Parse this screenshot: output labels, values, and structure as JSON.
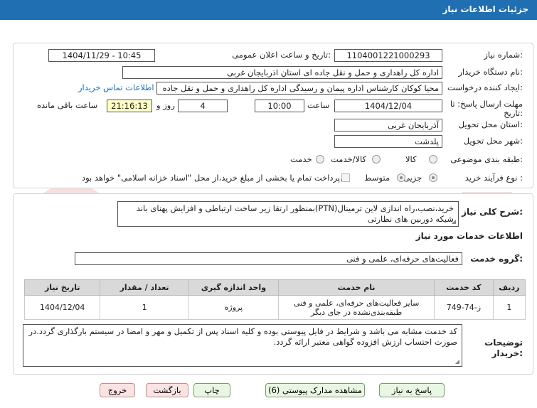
{
  "header": {
    "title": "جزئیات اطلاعات نیاز"
  },
  "form": {
    "need_number_label": "شماره نیاز:",
    "need_number": "1104001221000293",
    "announce_label": "تاریخ و ساعت اعلان عمومی:",
    "announce_value": "1404/11/29 - 10:45",
    "buyer_label": "نام دستگاه خریدار:",
    "buyer_value": "اداره کل راهداری و حمل و نقل جاده ای استان اذربایجان غربی",
    "creator_label": "ایجاد کننده درخواست:",
    "creator_value": "محیا کوکان کارشناس اداره پیمان و رسیدگی اداره کل راهداری و حمل و نقل جاده",
    "contact_link": "اطلاعات تماس خریدار",
    "deadline_label_1": "مهلت ارسال پاسخ: تا",
    "deadline_label_2": "تاریخ:",
    "deadline_date": "1404/12/04",
    "time_label": "ساعت",
    "deadline_time": "10:00",
    "days_value": "4",
    "days_label": "روز و",
    "remaining_time": "21:16:13",
    "remaining_label": "ساعت باقی مانده",
    "province_label": "استان محل تحویل:",
    "province_value": "آذربایجان غربی",
    "city_label": "شهر محل تحویل:",
    "city_value": "پلدشت",
    "category_label": "طبقه بندی موضوعی:",
    "category_options": [
      "کالا",
      "کالا/خدمت",
      "خدمت"
    ],
    "process_label": "نوع فرآیند خرید :",
    "process_options": [
      "جزیی",
      "متوسط"
    ],
    "payment_note": "پرداخت تمام یا بخشی از مبلغ خرید،از محل \"اسناد خزانه اسلامی\" خواهد بود."
  },
  "description": {
    "label": "شرح کلی نیاز:",
    "text": "خرید،نصب،راه اندازی لاین ترمینال(PTN)بمنظور ارتقا زیر ساخت ارتباطی و افزایش پهنای باند شبکه دوربین های نظارتی"
  },
  "services": {
    "section_title": "اطلاعات خدمات مورد نیاز",
    "group_label": "گروه خدمت:",
    "group_value": "فعالیت‌های حرفه‌ای، علمی و فنی",
    "columns": [
      "ردیف",
      "کد خدمت",
      "نام خدمت",
      "واحد اندازه گیری",
      "تعداد / مقدار",
      "تاریخ نیاز"
    ],
    "rows": [
      {
        "idx": "1",
        "code": "ز-74-749",
        "name": "سایر فعالیت‌های حرفه‌ای، علمی و فنی طبقه‌بندی‌نشده در جای دیگر",
        "unit": "پروژه",
        "qty": "1",
        "date": "1404/12/04"
      }
    ]
  },
  "buyer_notes": {
    "label_1": "توضیحات",
    "label_2": "خریدار:",
    "text": "کد خدمت مشابه می باشد و شرایط در فایل پیوستی بوده و کلیه اسناد پس از تکمیل و مهر و امضا در سیستم بارگذاری گردد.در صورت احتساب ارزش افزوده گواهی معتبر ارائه گردد."
  },
  "buttons": {
    "reply": "پاسخ به نیاز",
    "attachments": "مشاهده مدارک پیوستی (6)",
    "print": "چاپ",
    "back": "بازگشت",
    "exit": "خروج"
  },
  "watermark": {
    "text": "AriaTender.net"
  },
  "colors": {
    "header": "#1f6fb2",
    "link": "#1f6fb2",
    "remaining_bg": "#ffffc6",
    "table_head": "#d9d9d9"
  }
}
